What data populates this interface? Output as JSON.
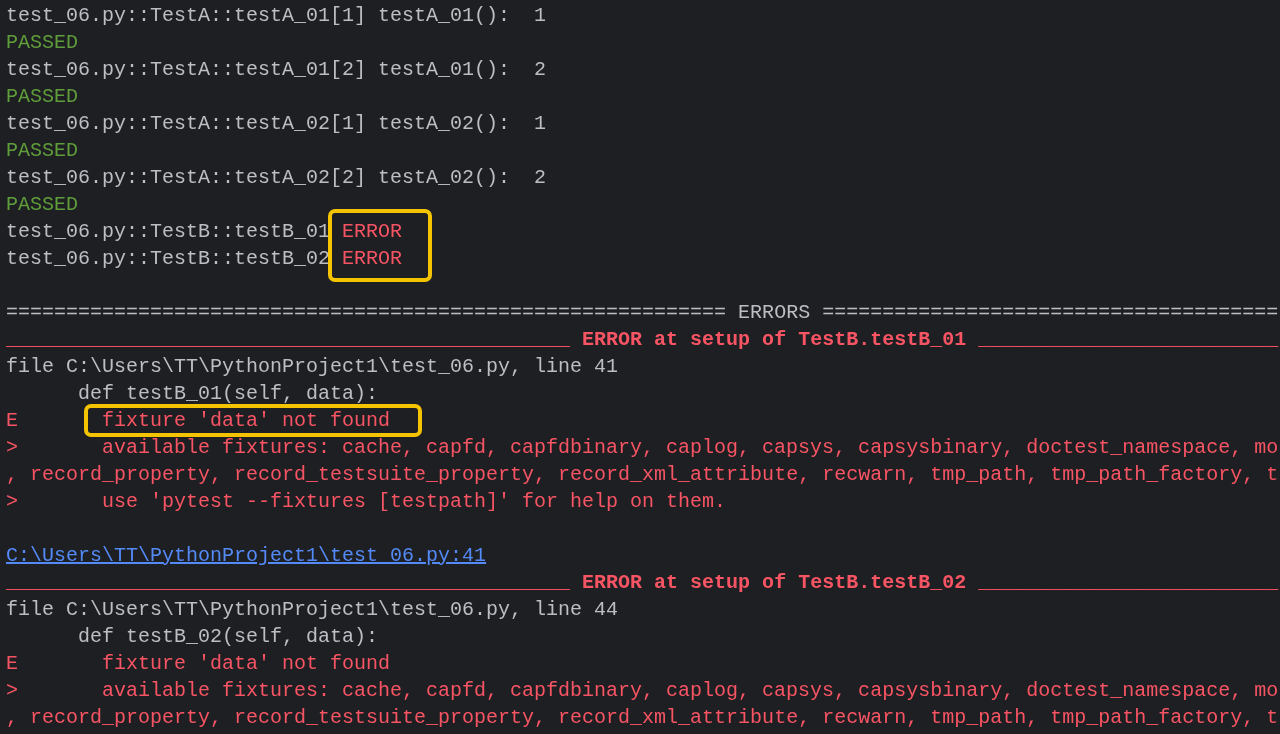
{
  "results": [
    {
      "test": "test_06.py::TestA::testA_01[1]",
      "output": "testA_01():  1",
      "status": "PASSED",
      "highlighted": false
    },
    {
      "test": "test_06.py::TestA::testA_01[2]",
      "output": "testA_01():  2",
      "status": "PASSED",
      "highlighted": false
    },
    {
      "test": "test_06.py::TestA::testA_02[1]",
      "output": "testA_02():  1",
      "status": "PASSED",
      "highlighted": false
    },
    {
      "test": "test_06.py::TestA::testA_02[2]",
      "output": "testA_02():  2",
      "status": "PASSED",
      "highlighted": false
    },
    {
      "test": "test_06.py::TestB::testB_01",
      "status": "ERROR",
      "highlighted": true
    },
    {
      "test": "test_06.py::TestB::testB_02",
      "status": "ERROR",
      "highlighted": true
    }
  ],
  "separator": "============================================================ ERRORS ======================================",
  "errors": [
    {
      "header": "_______________________________________________ ERROR at setup of TestB.testB_01 _________________________",
      "file": "file C:\\Users\\TT\\PythonProject1\\test_06.py, line 41",
      "def": "def testB_01(self, data):",
      "lines": [
        {
          "marker": "E",
          "text": "fixture 'data' not found",
          "highlighted": true
        },
        {
          "marker": ">",
          "text": "available fixtures: cache, capfd, capfdbinary, caplog, capsys, capsysbinary, doctest_namespace, mo",
          "highlighted": false
        },
        {
          "text": ", record_property, record_testsuite_property, record_xml_attribute, recwarn, tmp_path, tmp_path_factory, t",
          "highlighted": false
        },
        {
          "marker": ">",
          "text": "use 'pytest --fixtures [testpath]' for help on them.",
          "highlighted": false
        }
      ],
      "link": "C:\\Users\\TT\\PythonProject1\\test_06.py:41"
    },
    {
      "header": "_______________________________________________ ERROR at setup of TestB.testB_02 _________________________",
      "file": "file C:\\Users\\TT\\PythonProject1\\test_06.py, line 44",
      "def": "def testB_02(self, data):",
      "lines": [
        {
          "marker": "E",
          "text": "fixture 'data' not found",
          "highlighted": false
        },
        {
          "marker": ">",
          "text": "available fixtures: cache, capfd, capfdbinary, caplog, capsys, capsysbinary, doctest_namespace, mo",
          "highlighted": false
        },
        {
          "text": ", record_property, record_testsuite_property, record_xml_attribute, recwarn, tmp_path, tmp_path_factory, t",
          "highlighted": false
        }
      ]
    }
  ]
}
